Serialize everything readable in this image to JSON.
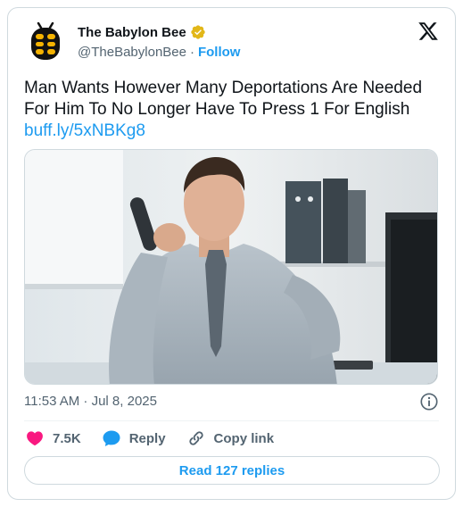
{
  "account": {
    "display_name": "The Babylon Bee",
    "handle": "@TheBabylonBee",
    "separator": "·",
    "follow_label": "Follow",
    "verified_icon": "verified-badge-icon",
    "brand_color": "#1d9bf0"
  },
  "tweet": {
    "text": "Man Wants However Many Deportations Are Needed For Him To No Longer Have To Press 1 For English ",
    "link": "buff.ly/5xNBKg8",
    "timestamp": "11:53 AM · Jul 8, 2025"
  },
  "actions": {
    "like_count": "7.5K",
    "reply_label": "Reply",
    "copy_link_label": "Copy link",
    "like_color": "#f91880"
  },
  "read_replies_label": "Read 127 replies",
  "icons": {
    "platform": "x-logo-icon",
    "info": "info-icon"
  }
}
